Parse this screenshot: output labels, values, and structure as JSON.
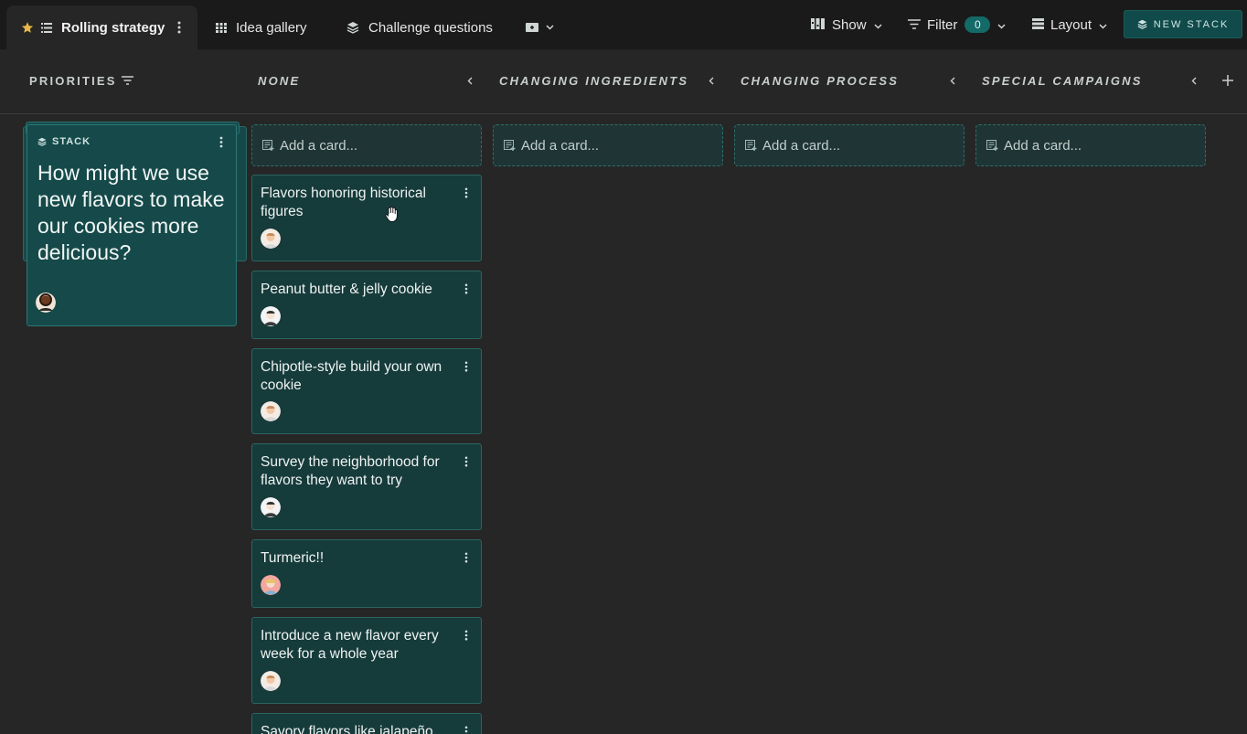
{
  "tabs": [
    {
      "label": "Rolling strategy",
      "active": true
    },
    {
      "label": "Idea gallery"
    },
    {
      "label": "Challenge questions"
    }
  ],
  "toolbar": {
    "show_label": "Show",
    "filter_label": "Filter",
    "filter_count": "0",
    "layout_label": "Layout",
    "new_stack_label": "NEW STACK"
  },
  "board": {
    "priorities_label": "PRIORITIES",
    "columns": [
      {
        "title": "NONE",
        "add_card": "Add a card..."
      },
      {
        "title": "CHANGING INGREDIENTS",
        "add_card": "Add a card..."
      },
      {
        "title": "CHANGING PROCESS",
        "add_card": "Add a card..."
      },
      {
        "title": "SPECIAL CAMPAIGNS",
        "add_card": "Add a card..."
      }
    ]
  },
  "stack": {
    "label": "STACK",
    "text": "How might we use new flavors to make our cookies more delicious?"
  },
  "cards": [
    {
      "title": "Flavors honoring historical figures"
    },
    {
      "title": "Peanut butter & jelly cookie"
    },
    {
      "title": "Chipotle-style build your own cookie"
    },
    {
      "title": "Survey the neighborhood for flavors they want to try"
    },
    {
      "title": "Turmeric!!"
    },
    {
      "title": "Introduce a new flavor every week for a whole year"
    },
    {
      "title": "Savory flavors like jalapeño"
    }
  ],
  "colors": {
    "accent": "#136a67",
    "card_bg": "#163b3b",
    "stack_bg": "#164a4a",
    "star": "#e7b84a"
  }
}
